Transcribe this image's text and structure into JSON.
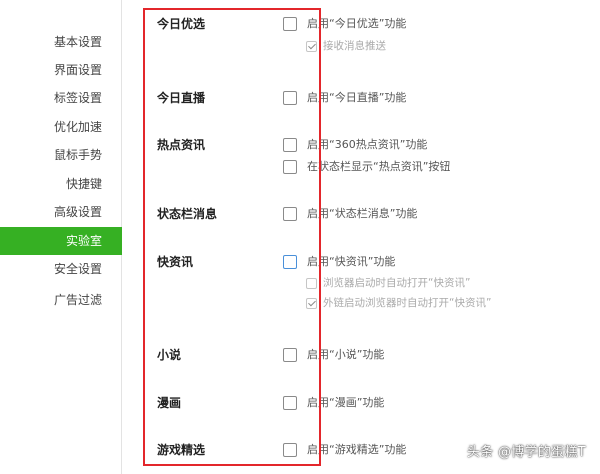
{
  "sidebar": {
    "items": [
      {
        "label": "基本设置"
      },
      {
        "label": "界面设置"
      },
      {
        "label": "标签设置"
      },
      {
        "label": "优化加速"
      },
      {
        "label": "鼠标手势"
      },
      {
        "label": "快捷键"
      },
      {
        "label": "高级设置"
      },
      {
        "label": "实验室",
        "active": true
      },
      {
        "label": "安全设置"
      },
      {
        "label": "广告过滤"
      }
    ]
  },
  "sections": [
    {
      "title": "今日优选",
      "options": [
        {
          "label": "启用“今日优选”功能",
          "checked": false
        },
        {
          "label": "接收消息推送",
          "checked": true,
          "disabled": true
        }
      ]
    },
    {
      "title": "今日直播",
      "options": [
        {
          "label": "启用“今日直播”功能",
          "checked": false
        }
      ]
    },
    {
      "title": "热点资讯",
      "options": [
        {
          "label": "启用“360热点资讯”功能",
          "checked": false
        },
        {
          "label": "在状态栏显示“热点资讯”按钮",
          "checked": false
        }
      ]
    },
    {
      "title": "状态栏消息",
      "options": [
        {
          "label": "启用“状态栏消息”功能",
          "checked": false
        }
      ]
    },
    {
      "title": "快资讯",
      "options": [
        {
          "label": "启用“快资讯”功能",
          "checked": false
        },
        {
          "label": "浏览器启动时自动打开“快资讯”",
          "checked": false,
          "disabled": true
        },
        {
          "label": "外链启动浏览器时自动打开“快资讯”",
          "checked": true,
          "disabled": true
        }
      ]
    },
    {
      "title": "小说",
      "options": [
        {
          "label": "启用“小说”功能",
          "checked": false
        }
      ]
    },
    {
      "title": "漫画",
      "options": [
        {
          "label": "启用“漫画”功能",
          "checked": false
        }
      ]
    },
    {
      "title": "游戏精选",
      "options": [
        {
          "label": "启用“游戏精选”功能",
          "checked": false
        }
      ]
    }
  ],
  "watermark": "头条 @博学的蛋糕T",
  "colors": {
    "active_bg": "#36b023",
    "highlight_border": "#e3262b",
    "focus_border": "#4a90d9"
  }
}
